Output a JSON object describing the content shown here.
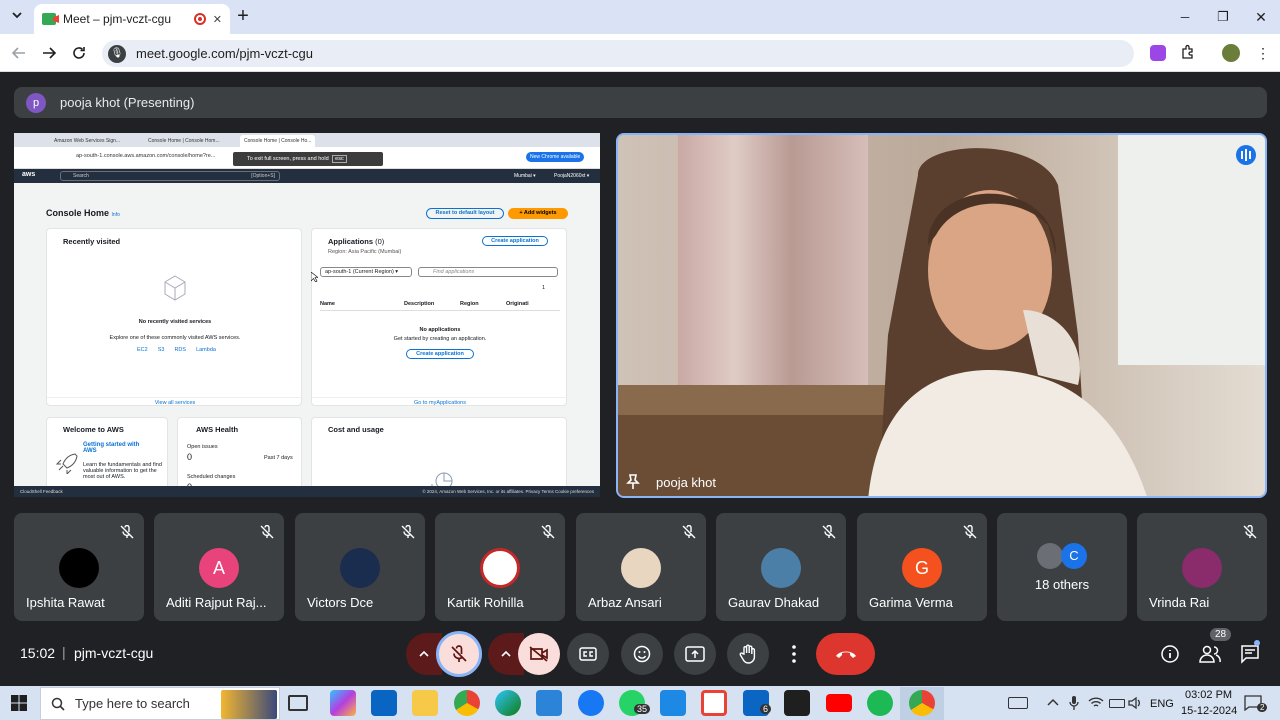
{
  "browser": {
    "tab_title": "Meet – pjm-vczt-cgu",
    "url": "meet.google.com/pjm-vczt-cgu",
    "tab_close": "✕",
    "new_tab": "+",
    "win_min": "─",
    "win_max": "❐",
    "win_close": "✕"
  },
  "meet": {
    "presenter_initial": "p",
    "presenter_label": "pooja khot (Presenting)",
    "speaker_name": "pooja khot",
    "participants": [
      {
        "name": "Ipshita Rawat",
        "initial": "",
        "color": "#000000"
      },
      {
        "name": "Aditi Rajput Raj...",
        "initial": "A",
        "color": "#e8437b"
      },
      {
        "name": "Victors Dce",
        "initial": "",
        "color": "#1b2d4e"
      },
      {
        "name": "Kartik Rohilla",
        "initial": "",
        "color": "#ffffff"
      },
      {
        "name": "Arbaz Ansari",
        "initial": "",
        "color": "#e8d6c0"
      },
      {
        "name": "Gaurav Dhakad",
        "initial": "",
        "color": "#4c7fa8"
      },
      {
        "name": "Garima Verma",
        "initial": "G",
        "color": "#f4511e"
      },
      {
        "name": "18 others",
        "initial": "C",
        "color": "#1a73e8"
      },
      {
        "name": "Vrinda Rai",
        "initial": "",
        "color": "#8a2b6b"
      }
    ],
    "time": "15:02",
    "separator": "|",
    "meeting_code": "pjm-vczt-cgu",
    "people_count": "28"
  },
  "shared_screen": {
    "tabs": [
      "Amazon Web Services Sign...",
      "Console Home | Console Hom...",
      "Console Home | Console Ho..."
    ],
    "address": "ap-south-1.console.aws.amazon.com/console/home?re...",
    "fullscreen_hint": "To exit full screen, press and hold",
    "esc": "esc",
    "new_chrome": "New Chrome available",
    "nav_logo": "aws",
    "nav_search": "Search",
    "nav_shortcut": "[Option+S]",
    "nav_region": "Mumbai ▾",
    "nav_account": "PoojaN2060xt ▾",
    "page_title": "Console Home",
    "info": "Info",
    "reset_btn": "Reset to default layout",
    "add_widgets": "+ Add widgets",
    "recent_title": "Recently visited",
    "recent_empty": "No recently visited services",
    "recent_explore": "Explore one of these commonly visited AWS services.",
    "services": [
      "EC2",
      "S3",
      "RDS",
      "Lambda"
    ],
    "view_all": "View all services",
    "apps_title": "Applications",
    "apps_count": "(0)",
    "create_app": "Create application",
    "region_line": "Region: Asia Pacific (Mumbai)",
    "region_select": "ap-south-1 (Current Region) ▾",
    "find_apps": "Find applications",
    "page_num": "1",
    "cols": [
      "Name",
      "Description",
      "Region",
      "Originati"
    ],
    "no_apps": "No applications",
    "get_started": "Get started by creating an application.",
    "create_app2": "Create application",
    "goto_apps": "Go to myApplications",
    "welcome_title": "Welcome to AWS",
    "getting_started": "Getting started with AWS",
    "learn": "Learn the fundamentals and find valuable information to get the most out of AWS.",
    "health_title": "AWS Health",
    "open_issues": "Open issues",
    "open_val": "0",
    "past7": "Past 7 days",
    "scheduled": "Scheduled changes",
    "sched_val": "0",
    "cost_title": "Cost and usage",
    "footer_left": "CloudShell   Feedback",
    "footer_right": "© 2024, Amazon Web Services, Inc. or its affiliates.   Privacy   Terms   Cookie preferences"
  },
  "taskbar": {
    "search_placeholder": "Type here to search",
    "whatsapp_badge": "35",
    "linkedin_badge": "6",
    "lang": "ENG",
    "time": "03:02 PM",
    "date": "15-12-2024",
    "notif": "2"
  }
}
